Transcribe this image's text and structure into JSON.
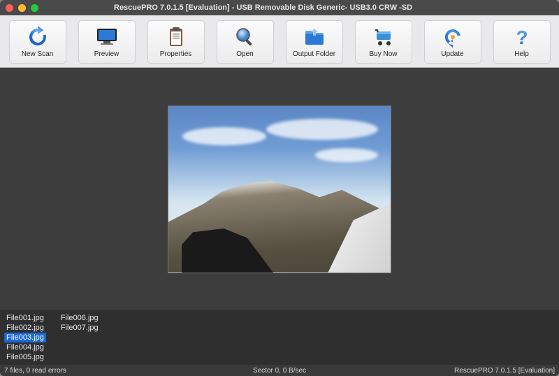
{
  "window": {
    "title": "RescuePRO 7.0.1.5 [Evaluation] - USB Removable Disk Generic- USB3.0 CRW   -SD"
  },
  "toolbar": {
    "new_scan": "New Scan",
    "preview": "Preview",
    "properties": "Properties",
    "open": "Open",
    "output_folder": "Output Folder",
    "buy_now": "Buy Now",
    "update": "Update",
    "help": "Help"
  },
  "files": [
    {
      "name": "File001.jpg",
      "selected": false
    },
    {
      "name": "File002.jpg",
      "selected": false
    },
    {
      "name": "File003.jpg",
      "selected": true
    },
    {
      "name": "File004.jpg",
      "selected": false
    },
    {
      "name": "File005.jpg",
      "selected": false
    },
    {
      "name": "File006.jpg",
      "selected": false
    },
    {
      "name": "File007.jpg",
      "selected": false
    }
  ],
  "status": {
    "left": "7 files, 0 read errors",
    "center": "Sector 0, 0 B/sec",
    "right": "RescuePRO 7.0.1.5 [Evaluation]"
  },
  "colors": {
    "brand_blue": "#2a7ad6",
    "selection": "#1a66d6"
  }
}
